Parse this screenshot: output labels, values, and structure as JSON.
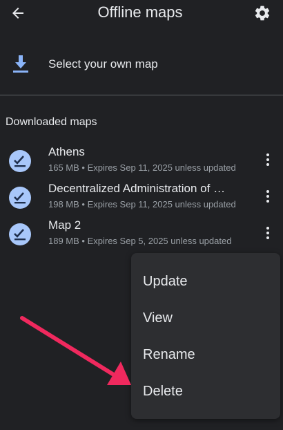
{
  "header": {
    "title": "Offline maps",
    "back_icon": "arrow-back-icon",
    "settings_icon": "gear-icon"
  },
  "select_map": {
    "label": "Select your own map",
    "icon": "download-icon"
  },
  "section": {
    "title": "Downloaded maps"
  },
  "maps": [
    {
      "name": "Athens",
      "meta": "165 MB • Expires Sep 11, 2025 unless updated"
    },
    {
      "name": "Decentralized Administration of …",
      "meta": "198 MB • Expires Sep 11, 2025 unless updated"
    },
    {
      "name": "Map 2",
      "meta": "189 MB • Expires Sep 5, 2025 unless updated"
    }
  ],
  "menu": {
    "items": [
      "Update",
      "View",
      "Rename",
      "Delete"
    ]
  },
  "colors": {
    "background": "#202124",
    "menu_background": "#2d2e31",
    "text_primary": "#e8eaed",
    "text_secondary": "#9aa0a6",
    "icon_accent": "#8ab4f8",
    "check_circle": "#a8c7fa",
    "annotation_arrow": "#f0295e"
  }
}
